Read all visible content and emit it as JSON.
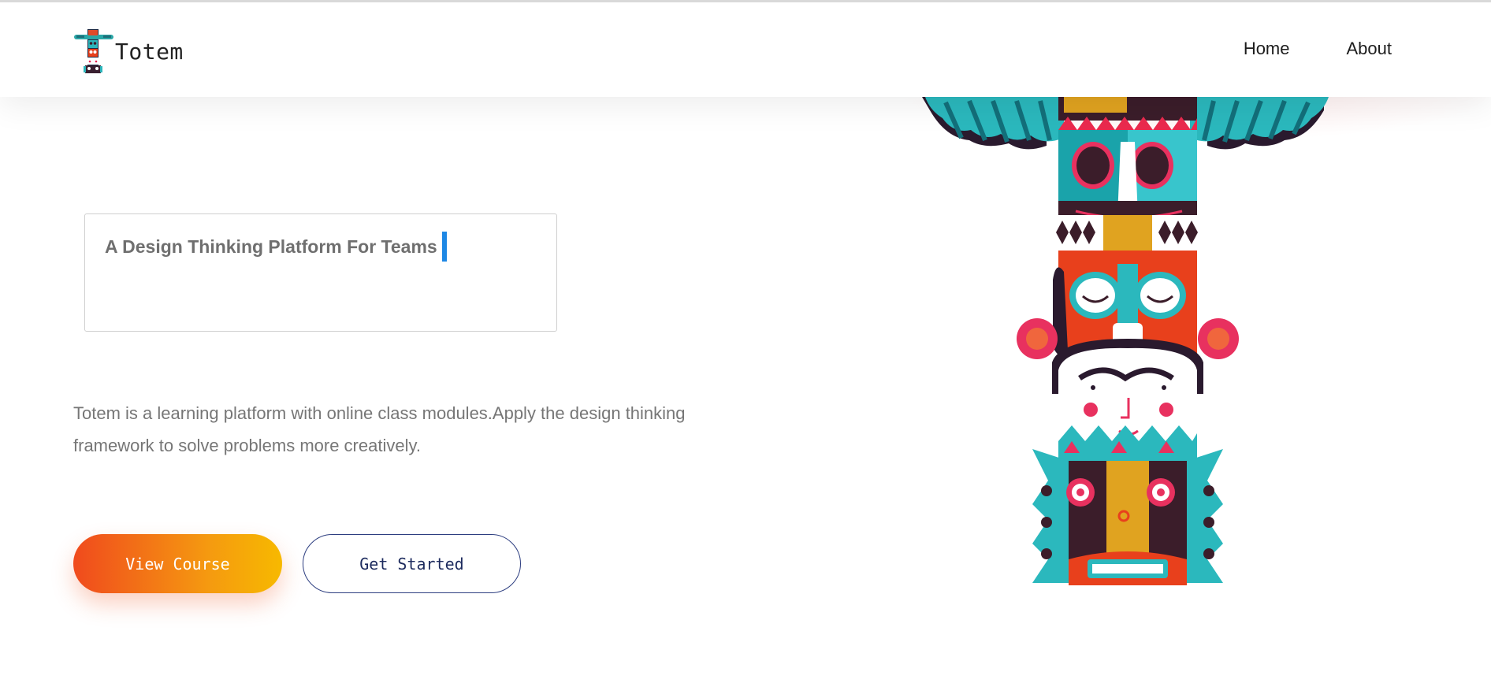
{
  "navbar": {
    "brand_name": "Totem",
    "links": [
      {
        "label": "Home"
      },
      {
        "label": "About"
      }
    ]
  },
  "hero": {
    "headline": "A Design Thinking Platform For Teams",
    "description": "Totem is a learning platform with online class modules.Apply the design thinking framework to solve problems more creatively.",
    "buttons": {
      "view_course": "View Course",
      "get_started": "Get Started"
    }
  },
  "colors": {
    "accent_blue": "#1e88e5",
    "button_gradient_start": "#f04a1d",
    "button_gradient_end": "#f7b900",
    "outline_navy": "#2d3e80"
  },
  "icons": {
    "brand_logo": "totem-logo-icon",
    "hero_art": "totem-pole-illustration"
  }
}
